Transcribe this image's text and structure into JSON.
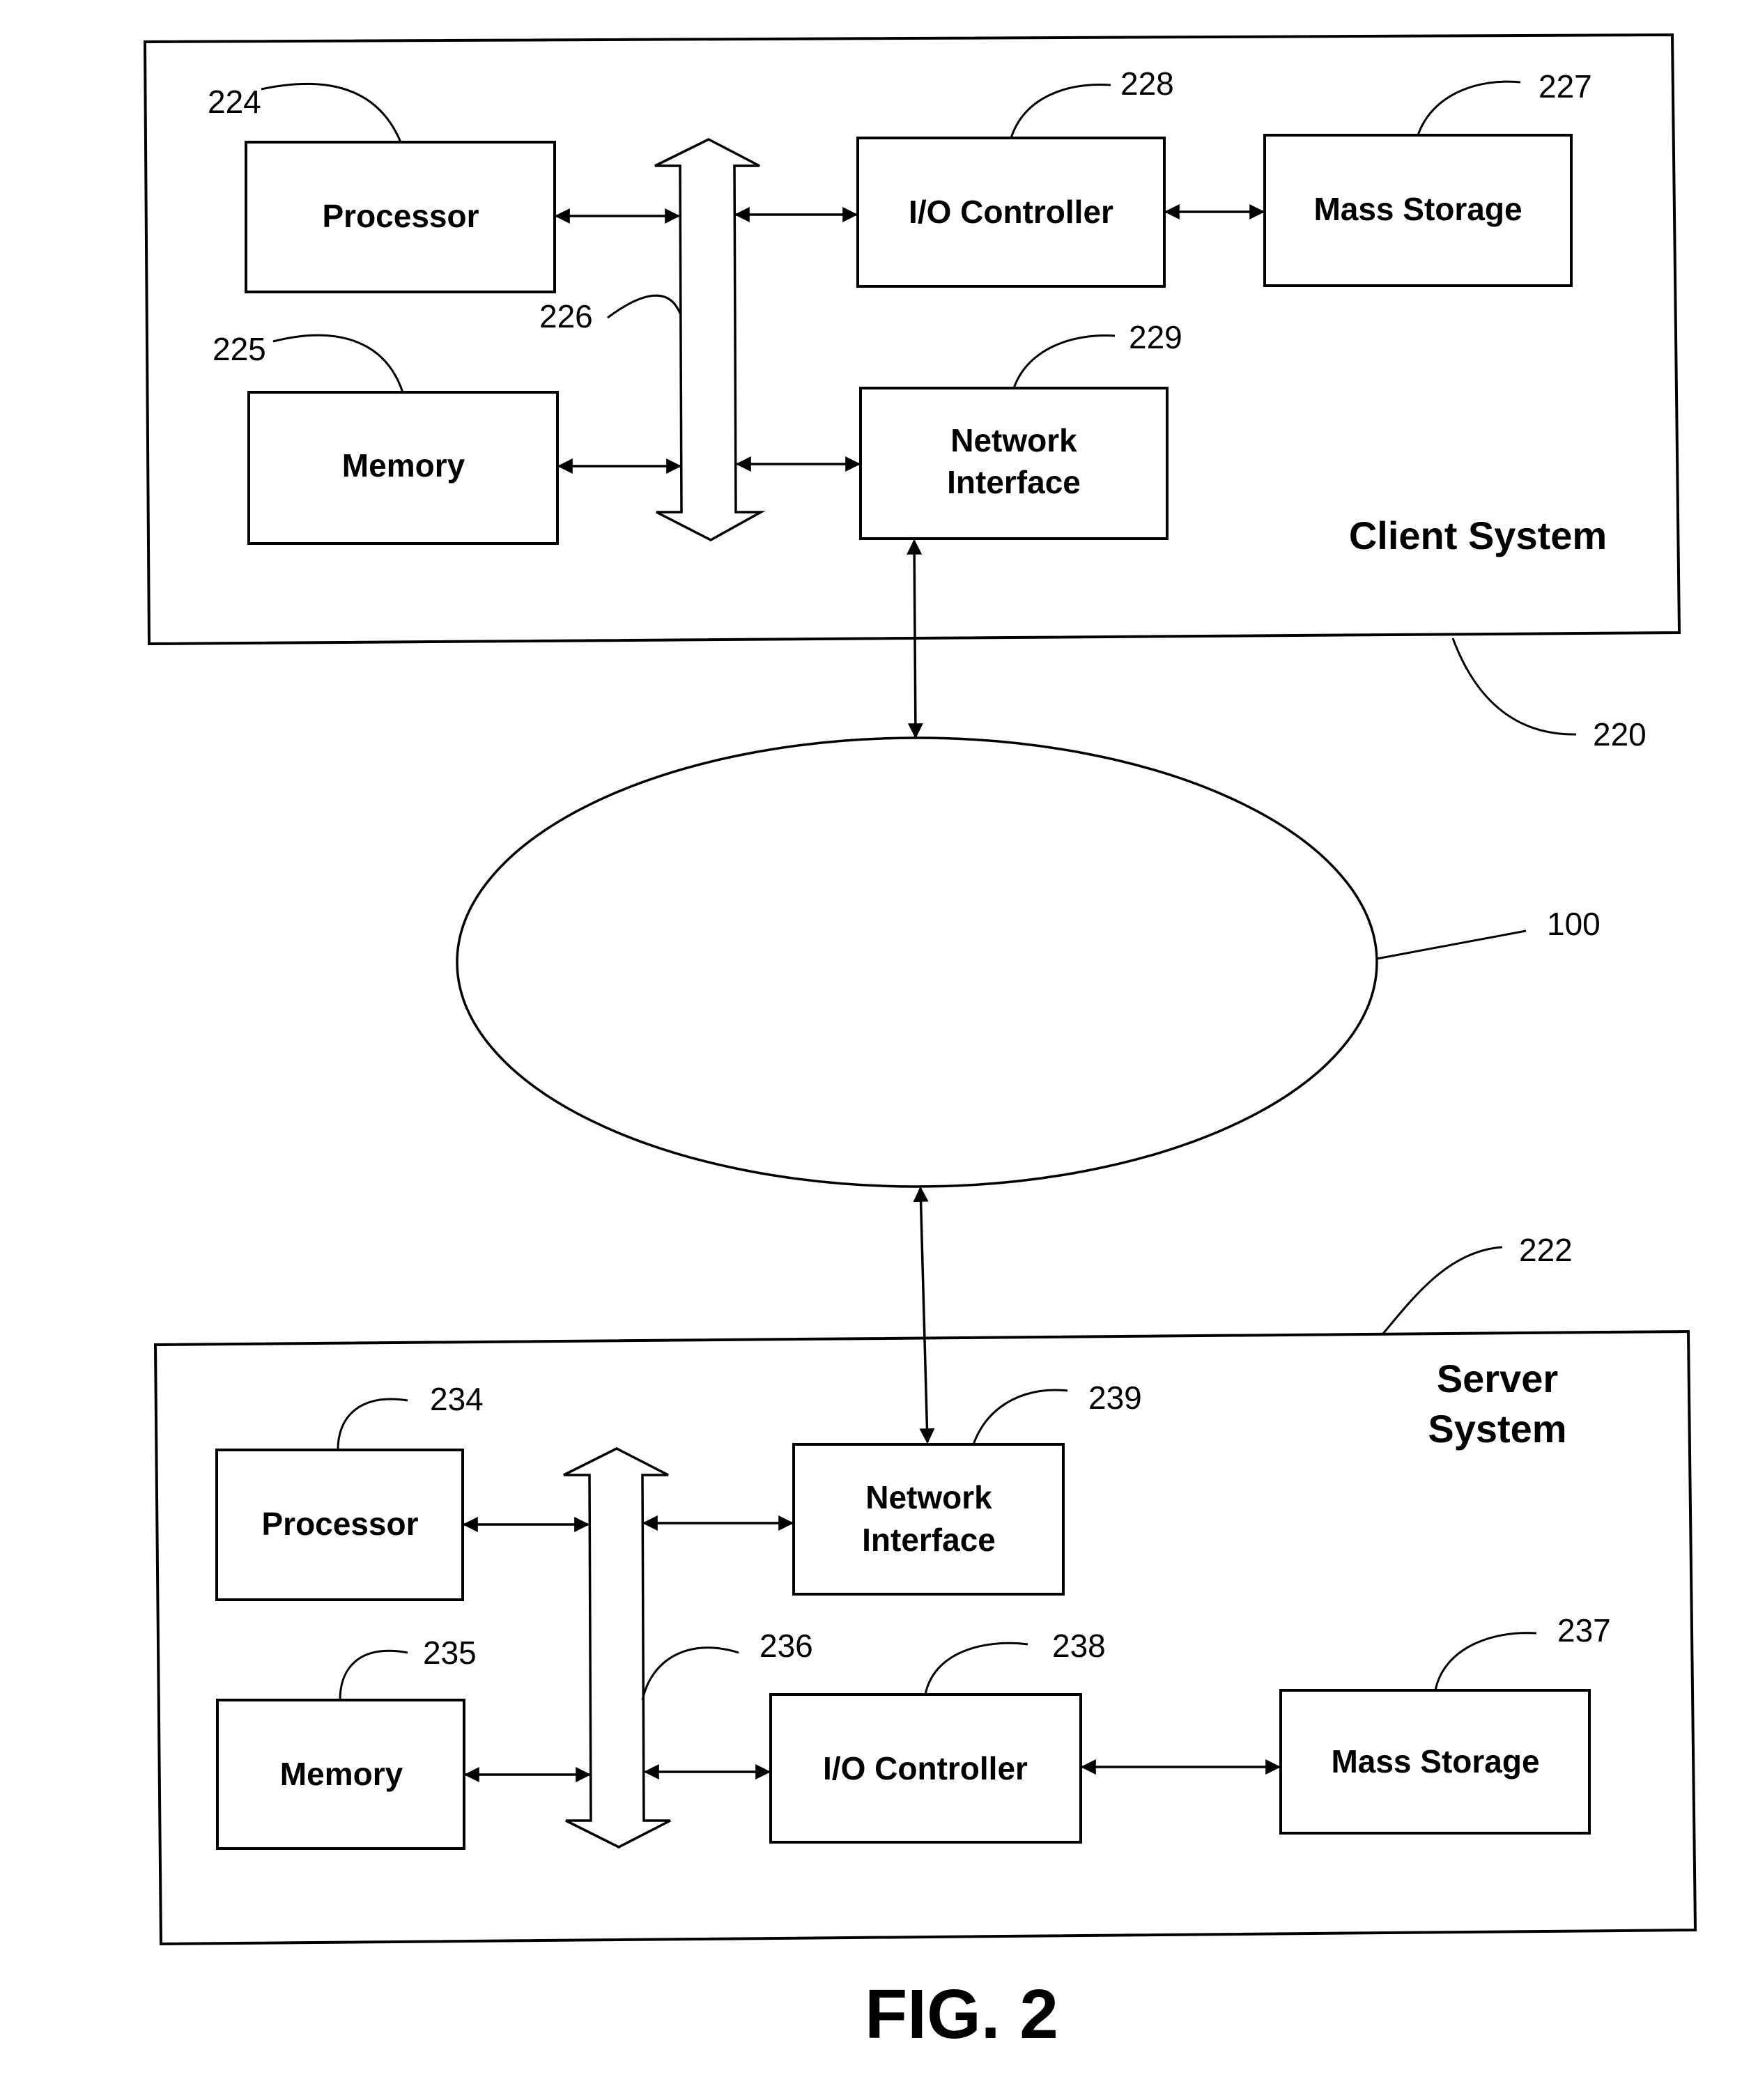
{
  "figure": {
    "caption": "FIG. 2"
  },
  "network": {
    "ref": "100"
  },
  "client": {
    "title": "Client System",
    "ref": "220",
    "processor": {
      "label": "Processor",
      "ref": "224"
    },
    "memory": {
      "label": "Memory",
      "ref": "225"
    },
    "bus": {
      "ref": "226"
    },
    "mass_storage": {
      "label": "Mass Storage",
      "ref": "227"
    },
    "io_controller": {
      "label": "I/O Controller",
      "ref": "228"
    },
    "network_interface": {
      "label_line1": "Network",
      "label_line2": "Interface",
      "ref": "229"
    }
  },
  "server": {
    "title_line1": "Server",
    "title_line2": "System",
    "ref": "222",
    "processor": {
      "label": "Processor",
      "ref": "234"
    },
    "memory": {
      "label": "Memory",
      "ref": "235"
    },
    "bus": {
      "ref": "236"
    },
    "mass_storage": {
      "label": "Mass Storage",
      "ref": "237"
    },
    "io_controller": {
      "label": "I/O Controller",
      "ref": "238"
    },
    "network_interface": {
      "label_line1": "Network",
      "label_line2": "Interface",
      "ref": "239"
    }
  }
}
